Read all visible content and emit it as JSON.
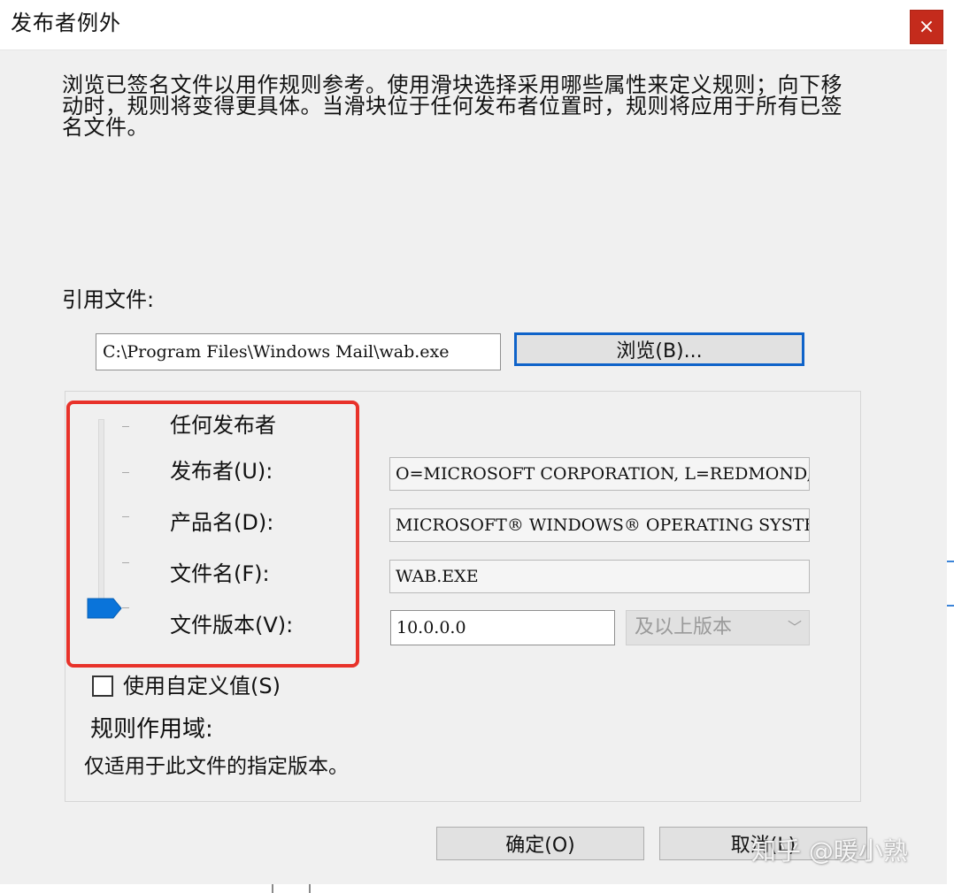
{
  "window": {
    "title": "发布者例外",
    "close_glyph": "×"
  },
  "description": "浏览已签名文件以用作规则参考。使用滑块选择采用哪些属性来定义规则；向下移动时，规则将变得更具体。当滑块位于任何发布者位置时，规则将应用于所有已签名文件。",
  "reference": {
    "label": "引用文件:",
    "path": "C:\\Program Files\\Windows Mail\\wab.exe",
    "browse_label": "浏览(B)..."
  },
  "levels": {
    "any_publisher": "任何发布者",
    "publisher": "发布者(U):",
    "product": "产品名(D):",
    "file_name": "文件名(F):",
    "file_version": "文件版本(V):"
  },
  "slider": {
    "selected_level": "文件版本(V):",
    "selected_index": 4,
    "level_count": 5
  },
  "fields": {
    "publisher_value": "O=MICROSOFT CORPORATION, L=REDMOND, S=W",
    "product_value": "MICROSOFT® WINDOWS® OPERATING SYSTEM",
    "file_name_value": "WAB.EXE",
    "file_version_value": "10.0.0.0",
    "version_option": "及以上版本"
  },
  "custom_value": {
    "label": "使用自定义值(S)",
    "checked": false
  },
  "scope": {
    "label": "规则作用域:",
    "text": "仅适用于此文件的指定版本。"
  },
  "buttons": {
    "ok": "确定(O)",
    "cancel": "取消(L)"
  },
  "watermark": "知乎 @暖小熟",
  "colors": {
    "accent": "#0f63c9",
    "close": "#c42b1c",
    "highlight": "#e8322a",
    "slider_thumb": "#0a74da"
  },
  "icons": {
    "close": "close-icon",
    "slider_thumb": "slider-thumb-icon",
    "dropdown": "chevron-down-icon"
  }
}
